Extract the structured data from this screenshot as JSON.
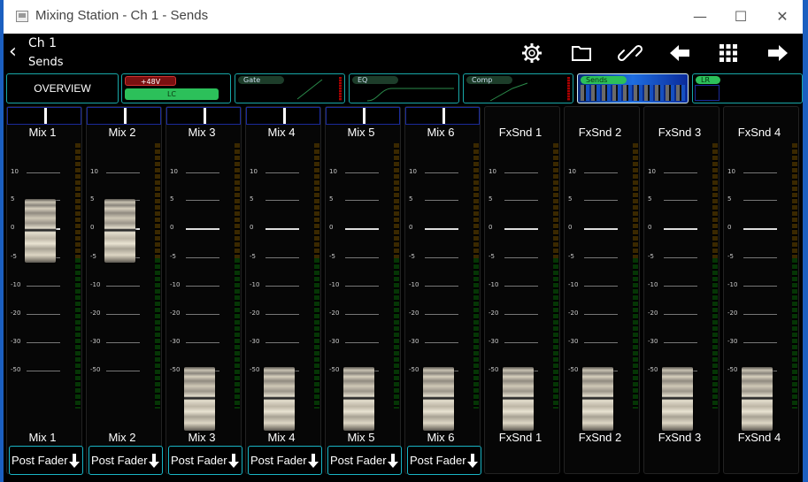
{
  "window": {
    "title": "Mixing Station - Ch 1 - Sends"
  },
  "header": {
    "channel": "Ch 1",
    "section": "Sends"
  },
  "tabs": {
    "overview": "OVERVIEW",
    "phantom": "+48V",
    "lowcut": "LC",
    "gate": "Gate",
    "eq": "EQ",
    "comp": "Comp",
    "sends": "Sends",
    "lr": "LR"
  },
  "scale_labels": [
    "10",
    "5",
    "0",
    "-5",
    "-10",
    "-20",
    "-30",
    "-50"
  ],
  "strips": [
    {
      "name": "Mix 1",
      "fader_db": "0",
      "tap": "Post Fader"
    },
    {
      "name": "Mix 2",
      "fader_db": "0",
      "tap": "Post Fader"
    },
    {
      "name": "Mix 3",
      "fader_db": "-inf",
      "tap": "Post Fader"
    },
    {
      "name": "Mix 4",
      "fader_db": "-inf",
      "tap": "Post Fader"
    },
    {
      "name": "Mix 5",
      "fader_db": "-inf",
      "tap": "Post Fader"
    },
    {
      "name": "Mix 6",
      "fader_db": "-inf",
      "tap": "Post Fader"
    },
    {
      "name": "FxSnd 1",
      "fader_db": "-inf",
      "tap": ""
    },
    {
      "name": "FxSnd 2",
      "fader_db": "-inf",
      "tap": ""
    },
    {
      "name": "FxSnd 3",
      "fader_db": "-inf",
      "tap": ""
    },
    {
      "name": "FxSnd 4",
      "fader_db": "-inf",
      "tap": ""
    }
  ],
  "colors": {
    "accent": "#19b4c4",
    "lowcut_on": "#2cc05a",
    "phantom": "#7a1010",
    "sends_active": "#2aa8ff"
  }
}
